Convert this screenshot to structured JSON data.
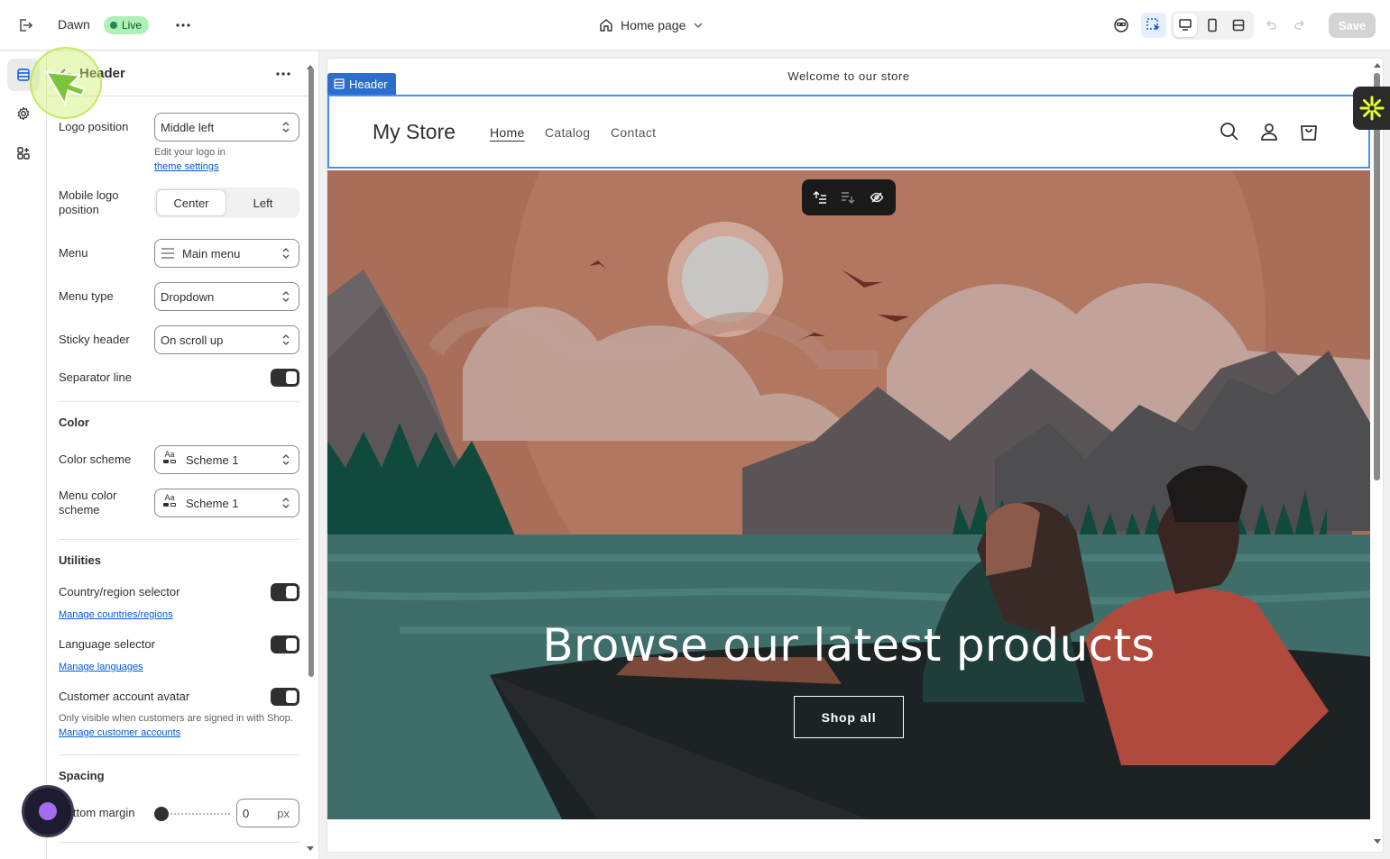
{
  "topbar": {
    "theme_name": "Dawn",
    "status": "Live",
    "page_selector": "Home page",
    "save_label": "Save"
  },
  "panel": {
    "title": "Header",
    "logo_position_label": "Logo position",
    "logo_position_value": "Middle left",
    "logo_help_text": "Edit your logo in",
    "logo_help_link": "theme settings",
    "mobile_logo_label": "Mobile logo position",
    "mobile_logo_options": [
      "Center",
      "Left"
    ],
    "menu_label": "Menu",
    "menu_value": "Main menu",
    "menu_type_label": "Menu type",
    "menu_type_value": "Dropdown",
    "sticky_label": "Sticky header",
    "sticky_value": "On scroll up",
    "separator_label": "Separator line",
    "color_section": "Color",
    "color_scheme_label": "Color scheme",
    "color_scheme_value": "Scheme 1",
    "menu_color_label": "Menu color scheme",
    "menu_color_value": "Scheme 1",
    "utilities_section": "Utilities",
    "country_label": "Country/region selector",
    "country_link": "Manage countries/regions",
    "language_label": "Language selector",
    "language_link": "Manage languages",
    "avatar_label": "Customer account avatar",
    "avatar_help": "Only visible when customers are signed in with Shop.",
    "avatar_link": "Manage customer accounts",
    "spacing_section": "Spacing",
    "bottom_margin_label": "Bottom margin",
    "bottom_margin_value": "0",
    "bottom_margin_unit": "px"
  },
  "preview": {
    "announcement": "Welcome to our store",
    "header_tag": "Header",
    "store_name": "My Store",
    "nav": [
      "Home",
      "Catalog",
      "Contact"
    ],
    "hero_title": "Browse our latest products",
    "hero_button": "Shop all"
  },
  "colors": {
    "accent": "#2c6ecb",
    "live_bg": "#aff0b5",
    "sidekick_yellow": "#e8ff34"
  }
}
